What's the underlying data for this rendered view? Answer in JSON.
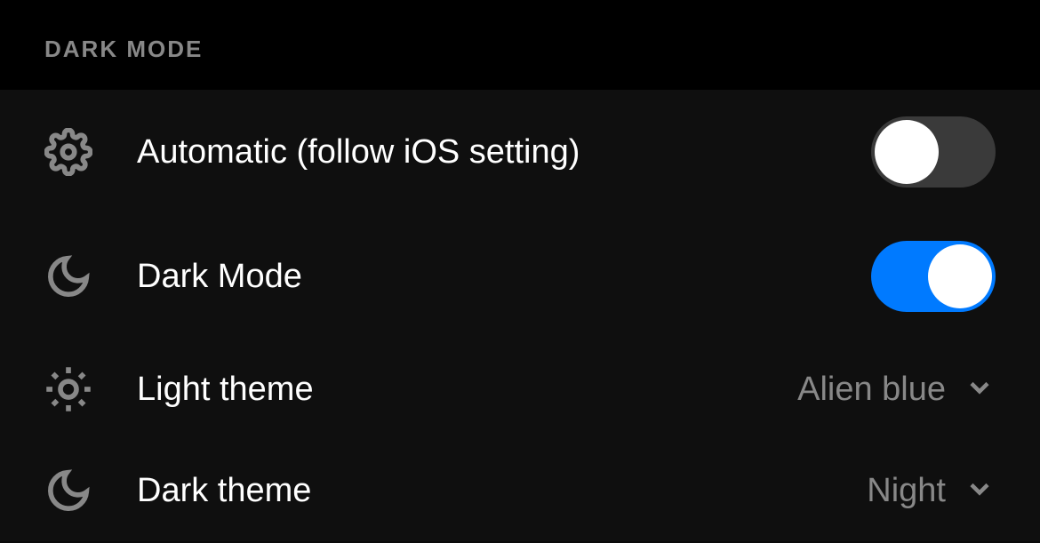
{
  "section": {
    "title": "DARK MODE"
  },
  "settings": {
    "automatic": {
      "label": "Automatic (follow iOS setting)",
      "enabled": false
    },
    "darkMode": {
      "label": "Dark Mode",
      "enabled": true
    },
    "lightTheme": {
      "label": "Light theme",
      "value": "Alien blue"
    },
    "darkTheme": {
      "label": "Dark theme",
      "value": "Night"
    }
  }
}
